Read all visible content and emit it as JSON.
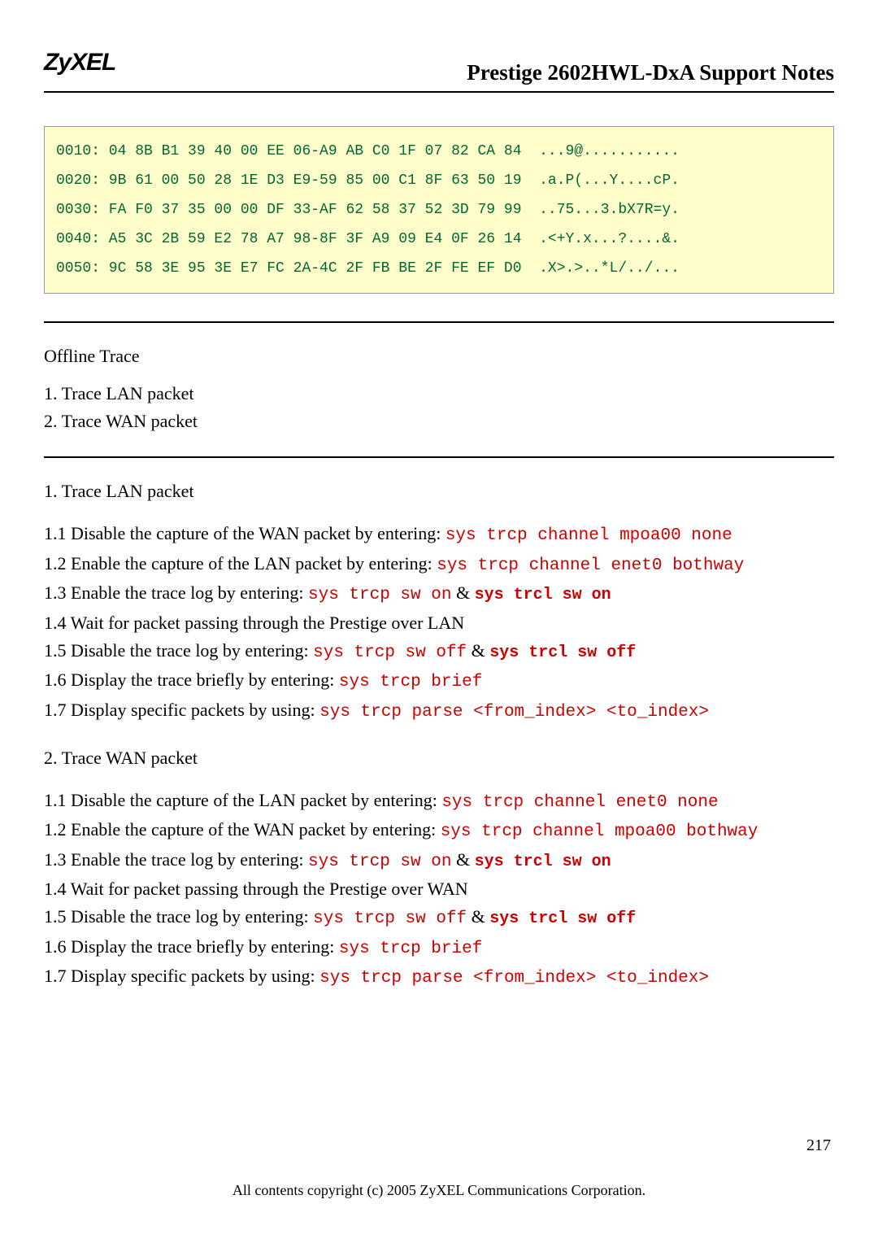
{
  "header": {
    "logo": "ZyXEL",
    "title": "Prestige 2602HWL-DxA Support Notes"
  },
  "hexdump": {
    "lines": [
      "0010: 04 8B B1 39 40 00 EE 06-A9 AB C0 1F 07 82 CA 84  ...9@...........",
      "0020: 9B 61 00 50 28 1E D3 E9-59 85 00 C1 8F 63 50 19  .a.P(...Y....cP.",
      "0030: FA F0 37 35 00 00 DF 33-AF 62 58 37 52 3D 79 99  ..75...3.bX7R=y.",
      "0040: A5 3C 2B 59 E2 78 A7 98-8F 3F A9 09 E4 0F 26 14  .<+Y.x...?....&.",
      "0050: 9C 58 3E 95 3E E7 FC 2A-4C 2F FB BE 2F FE EF D0  .X>.>..*L/../..."
    ]
  },
  "offline": {
    "title": "Offline Trace",
    "items": [
      "1. Trace LAN packet",
      "2. Trace WAN packet"
    ]
  },
  "lan": {
    "title": "1. Trace LAN packet",
    "steps": {
      "s11a": "1.1 Disable the capture of the WAN packet by entering: ",
      "s11b": "sys trcp channel mpoa00 none",
      "s12a": "1.2 Enable the capture of the LAN packet by entering: ",
      "s12b": "sys trcp channel enet0 bothway",
      "s13a": "1.3 Enable the trace log by entering: ",
      "s13b": "sys trcp sw on",
      "s13c": " & ",
      "s13d": "sys trcl sw on",
      "s14": "1.4 Wait for packet passing through the Prestige over LAN",
      "s15a": "1.5 Disable the trace log by entering: ",
      "s15b": "sys trcp sw off",
      "s15c": " & ",
      "s15d": "sys trcl sw off",
      "s16a": "1.6 Display the trace briefly by entering: ",
      "s16b": "sys trcp brief",
      "s17a": "1.7 Display specific packets by using: ",
      "s17b": "sys trcp parse <from_index> <to_index>"
    }
  },
  "wan": {
    "title": "2. Trace WAN packet",
    "steps": {
      "s11a": "1.1 Disable the capture of the LAN packet by entering: ",
      "s11b": "sys trcp channel enet0 none",
      "s12a": "1.2 Enable the capture of the WAN packet by entering: ",
      "s12b": "sys trcp channel mpoa00 bothway",
      "s13a": "1.3 Enable the trace log by entering: ",
      "s13b": "sys trcp sw on",
      "s13c": " & ",
      "s13d": "sys trcl sw on",
      "s14": "1.4 Wait for packet passing through the Prestige over WAN",
      "s15a": "1.5 Disable the trace log by entering: ",
      "s15b": "sys trcp sw off",
      "s15c": " & ",
      "s15d": "sys trcl sw off",
      "s16a": "1.6 Display the trace briefly by entering: ",
      "s16b": "sys trcp brief",
      "s17a": "1.7 Display specific packets by using: ",
      "s17b": "sys trcp parse <from_index> <to_index>"
    }
  },
  "footer": {
    "copyright": "All contents copyright (c) 2005 ZyXEL Communications Corporation.",
    "page": "217"
  }
}
